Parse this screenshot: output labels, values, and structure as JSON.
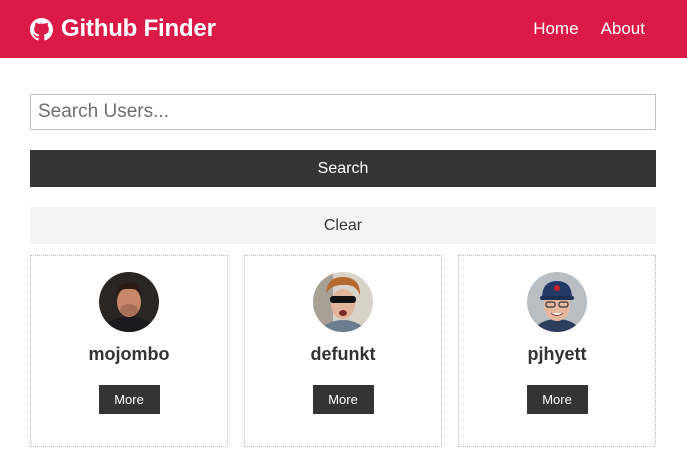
{
  "navbar": {
    "brand_icon": "github-icon",
    "title": "Github Finder",
    "links": [
      {
        "label": "Home"
      },
      {
        "label": "About"
      }
    ],
    "colors": {
      "background": "#dc1a48",
      "text": "#ffffff"
    }
  },
  "search": {
    "placeholder": "Search Users...",
    "value": "",
    "submit_label": "Search",
    "clear_label": "Clear"
  },
  "users": [
    {
      "login": "mojombo",
      "more_label": "More"
    },
    {
      "login": "defunkt",
      "more_label": "More"
    },
    {
      "login": "pjhyett",
      "more_label": "More"
    }
  ]
}
